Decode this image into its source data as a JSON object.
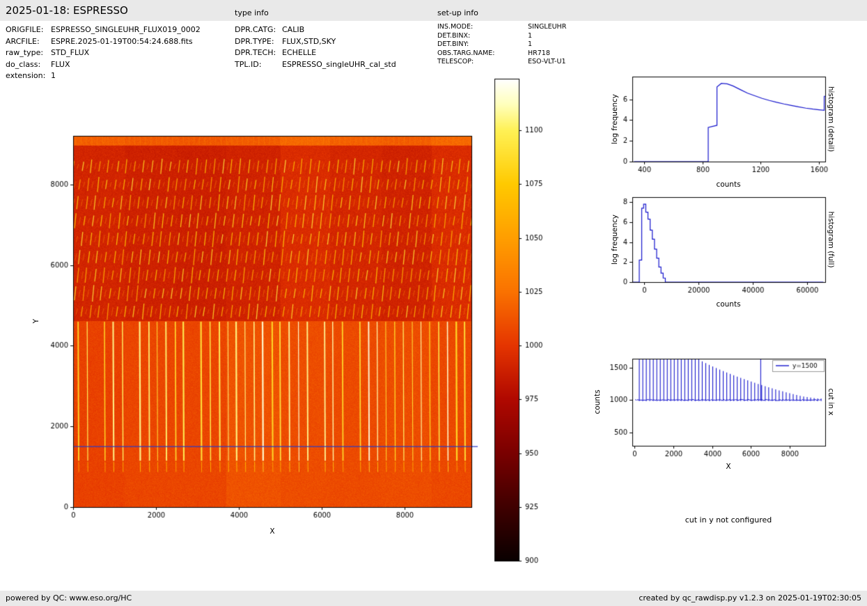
{
  "header": {
    "title": "2025-01-18: ESPRESSO",
    "type_info_label": "type info",
    "setup_info_label": "set-up info"
  },
  "file_info": {
    "rows": [
      {
        "label": "ORIGFILE:",
        "value": "ESPRESSO_SINGLEUHR_FLUX019_0002"
      },
      {
        "label": "ARCFILE:",
        "value": "ESPRE.2025-01-19T00:54:24.688.fits"
      },
      {
        "label": "raw_type:",
        "value": "STD_FLUX"
      },
      {
        "label": "do_class:",
        "value": "FLUX"
      },
      {
        "label": "extension:",
        "value": "1"
      }
    ]
  },
  "type_info": {
    "rows": [
      {
        "label": "DPR.CATG:",
        "value": "CALIB"
      },
      {
        "label": "DPR.TYPE:",
        "value": "FLUX,STD,SKY"
      },
      {
        "label": "DPR.TECH:",
        "value": "ECHELLE"
      },
      {
        "label": "TPL.ID:",
        "value": "ESPRESSO_singleUHR_cal_std"
      }
    ]
  },
  "setup_info": {
    "rows": [
      {
        "label": "INS.MODE:",
        "value": "SINGLEUHR"
      },
      {
        "label": "DET.BINX:",
        "value": "1"
      },
      {
        "label": "DET.BINY:",
        "value": "1"
      },
      {
        "label": "OBS.TARG.NAME:",
        "value": "HR718"
      },
      {
        "label": "TELESCOP:",
        "value": "ESO-VLT-U1"
      }
    ]
  },
  "cut_y_note": "cut in y not configured",
  "footer": {
    "left": "powered by QC: www.eso.org/HC",
    "right": "created by qc_rawdisp.py v1.2.3 on 2025-01-19T02:30:05"
  },
  "chart_data": [
    {
      "id": "raw_image",
      "type": "heatmap",
      "xlabel": "X",
      "ylabel": "Y",
      "xlim": [
        0,
        9610
      ],
      "ylim": [
        0,
        9206
      ],
      "xticks": [
        0,
        2000,
        4000,
        6000,
        8000
      ],
      "yticks": [
        0,
        2000,
        4000,
        6000,
        8000
      ],
      "cut_line": {
        "y": 1500,
        "color": "#2a3bc8"
      },
      "colorbar": {
        "vmin": 900,
        "vmax": 1124,
        "ticks": [
          900,
          925,
          950,
          975,
          1000,
          1025,
          1050,
          1075,
          1100
        ]
      },
      "colormap": [
        [
          900,
          "#0a0000"
        ],
        [
          925,
          "#400000"
        ],
        [
          950,
          "#7a0000"
        ],
        [
          975,
          "#b00800"
        ],
        [
          1000,
          "#e53500"
        ],
        [
          1025,
          "#fa7200"
        ],
        [
          1050,
          "#ff9e00"
        ],
        [
          1075,
          "#ffc900"
        ],
        [
          1100,
          "#fff155"
        ],
        [
          1112,
          "#ffffbb"
        ],
        [
          1124,
          "#ffffff"
        ]
      ],
      "image_model": {
        "split_y": 4620,
        "top_strip_y": 8960,
        "lower_base": 1007,
        "upper_base": 991,
        "top_strip_base": 1017,
        "noise": 6,
        "band_bounds": [
          1250,
          2500,
          3700,
          5000,
          6200,
          7450,
          8650
        ],
        "band_offsets_lower": [
          -2,
          0,
          0,
          5,
          3,
          2,
          3,
          1
        ],
        "band_offsets_upper": [
          0,
          -2,
          -3,
          -1,
          4,
          1,
          -1,
          4
        ],
        "order_spacing": 212,
        "order_x0": 130,
        "order_y_range": [
          1150,
          4600
        ],
        "order_value": 1102,
        "lower_dash_y": [
          870,
          1120
        ],
        "upper_rows_y0": 4850,
        "upper_row_step": 450,
        "upper_row_shift": 55,
        "upper_dash_halflen": 160,
        "upper_value": 1072
      }
    },
    {
      "id": "hist_detail",
      "type": "line",
      "xlabel": "counts",
      "ylabel": "log frequency",
      "side_label": "histogram (detail)",
      "xlim": [
        319,
        1643
      ],
      "ylim": [
        0,
        8.2
      ],
      "xticks": [
        400,
        800,
        1200,
        1600
      ],
      "yticks": [
        0,
        2,
        4,
        6
      ],
      "line_color": "#1414cc",
      "points": [
        [
          330,
          0
        ],
        [
          840,
          0
        ],
        [
          840,
          3.3
        ],
        [
          900,
          3.5
        ],
        [
          900,
          7.2
        ],
        [
          930,
          7.55
        ],
        [
          970,
          7.5
        ],
        [
          1010,
          7.3
        ],
        [
          1060,
          6.95
        ],
        [
          1110,
          6.6
        ],
        [
          1160,
          6.35
        ],
        [
          1210,
          6.1
        ],
        [
          1260,
          5.9
        ],
        [
          1310,
          5.72
        ],
        [
          1360,
          5.56
        ],
        [
          1410,
          5.42
        ],
        [
          1460,
          5.28
        ],
        [
          1510,
          5.16
        ],
        [
          1560,
          5.06
        ],
        [
          1600,
          5.0
        ],
        [
          1636,
          4.95
        ],
        [
          1636,
          6.3
        ],
        [
          1643,
          6.3
        ]
      ]
    },
    {
      "id": "hist_full",
      "type": "line",
      "xlabel": "counts",
      "ylabel": "log frequency",
      "side_label": "histogram (full)",
      "xlim": [
        -4360,
        66660
      ],
      "ylim": [
        0,
        8.5
      ],
      "xticks": [
        0,
        20000,
        40000,
        60000
      ],
      "yticks": [
        0,
        2,
        4,
        6,
        8
      ],
      "line_color": "#1414cc",
      "points": [
        [
          -4300,
          0
        ],
        [
          -1800,
          0
        ],
        [
          -1800,
          2.2
        ],
        [
          -900,
          2.2
        ],
        [
          -900,
          7.4
        ],
        [
          -200,
          7.4
        ],
        [
          -200,
          7.8
        ],
        [
          600,
          7.8
        ],
        [
          600,
          7.0
        ],
        [
          1400,
          7.0
        ],
        [
          1400,
          6.3
        ],
        [
          2200,
          6.3
        ],
        [
          2200,
          5.2
        ],
        [
          3000,
          5.2
        ],
        [
          3000,
          4.3
        ],
        [
          3800,
          4.3
        ],
        [
          3800,
          3.3
        ],
        [
          4600,
          3.3
        ],
        [
          4600,
          2.4
        ],
        [
          5400,
          2.4
        ],
        [
          5400,
          1.5
        ],
        [
          6200,
          1.5
        ],
        [
          6200,
          0.9
        ],
        [
          7000,
          0.9
        ],
        [
          7000,
          0.4
        ],
        [
          7800,
          0.4
        ],
        [
          7800,
          0
        ],
        [
          66000,
          0
        ]
      ]
    },
    {
      "id": "cut_x",
      "type": "cut",
      "xlabel": "X",
      "ylabel": "counts",
      "side_label": "cut in x",
      "legend_label": "y=1500",
      "xlim": [
        -110,
        9820
      ],
      "ylim": [
        290,
        1640
      ],
      "xticks": [
        0,
        2000,
        4000,
        6000,
        8000
      ],
      "yticks": [
        500,
        1000,
        1500
      ],
      "line_color": "#1414cc",
      "baseline": 1000,
      "baseline_noise": 8,
      "full_spike_x": 6500,
      "spikes": [
        [
          250,
          1650
        ],
        [
          430,
          1650
        ],
        [
          610,
          1650
        ],
        [
          790,
          1650
        ],
        [
          970,
          1650
        ],
        [
          1150,
          1650
        ],
        [
          1330,
          1650
        ],
        [
          1510,
          1650
        ],
        [
          1690,
          1650
        ],
        [
          1870,
          1650
        ],
        [
          2050,
          1650
        ],
        [
          2230,
          1650
        ],
        [
          2410,
          1650
        ],
        [
          2590,
          1650
        ],
        [
          2770,
          1650
        ],
        [
          2950,
          1650
        ],
        [
          3130,
          1650
        ],
        [
          3310,
          1650
        ],
        [
          3490,
          1600
        ],
        [
          3670,
          1572
        ],
        [
          3850,
          1545
        ],
        [
          4030,
          1520
        ],
        [
          4210,
          1496
        ],
        [
          4390,
          1472
        ],
        [
          4570,
          1449
        ],
        [
          4750,
          1427
        ],
        [
          4930,
          1405
        ],
        [
          5110,
          1384
        ],
        [
          5290,
          1363
        ],
        [
          5470,
          1343
        ],
        [
          5650,
          1323
        ],
        [
          5830,
          1304
        ],
        [
          6010,
          1285
        ],
        [
          6190,
          1267
        ],
        [
          6370,
          1249
        ],
        [
          6550,
          1231
        ],
        [
          6730,
          1214
        ],
        [
          6910,
          1197
        ],
        [
          7090,
          1181
        ],
        [
          7270,
          1165
        ],
        [
          7450,
          1149
        ],
        [
          7630,
          1134
        ],
        [
          7810,
          1119
        ],
        [
          7990,
          1105
        ],
        [
          8170,
          1091
        ],
        [
          8350,
          1078
        ],
        [
          8530,
          1066
        ],
        [
          8710,
          1055
        ],
        [
          8890,
          1045
        ],
        [
          9070,
          1037
        ],
        [
          9250,
          1030
        ],
        [
          9430,
          1025
        ],
        [
          9610,
          1021
        ]
      ]
    }
  ]
}
